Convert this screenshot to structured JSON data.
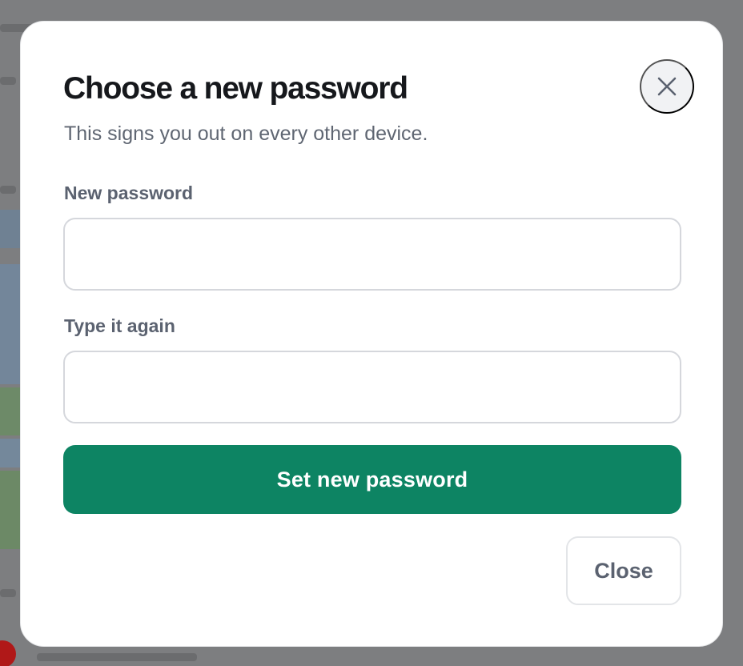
{
  "dialog": {
    "title": "Choose a new password",
    "subtitle": "This signs you out on every other device.",
    "close_icon": "close-icon",
    "fields": [
      {
        "label": "New password",
        "value": "",
        "placeholder": ""
      },
      {
        "label": "Type it again",
        "value": "",
        "placeholder": ""
      }
    ],
    "primary_button": "Set new password",
    "secondary_button": "Close"
  },
  "colors": {
    "primary": "#0d8463",
    "title": "#16181c",
    "muted_text": "#5f6672",
    "input_border": "#d5d7dc",
    "overlay": "#7d7e80"
  }
}
